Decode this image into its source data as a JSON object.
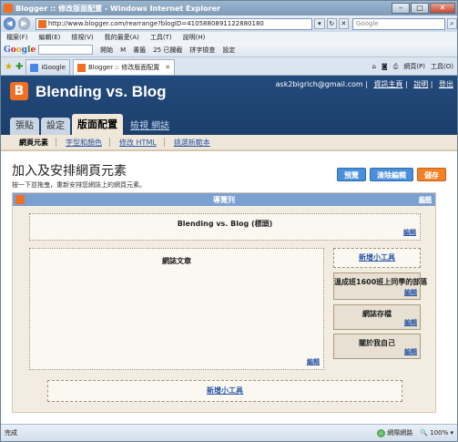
{
  "window": {
    "title": "Blogger :: 修改版面配置 - Windows Internet Explorer",
    "controls": {
      "minimize": "–",
      "maximize": "□",
      "close": "✕"
    }
  },
  "address": {
    "url": "http://www.blogger.com/rearrange?blogID=4105880891122880180",
    "search_placeholder": "Google"
  },
  "menu": [
    "檔案(F)",
    "編輯(E)",
    "檢視(V)",
    "我的最愛(A)",
    "工具(T)",
    "說明(H)"
  ],
  "google_toolbar": {
    "logo": [
      "G",
      "o",
      "o",
      "g",
      "l",
      "e"
    ],
    "items": [
      "開始",
      "M",
      "書籤",
      "25 已攔截",
      "拼字檢查",
      "設定"
    ]
  },
  "tabs": [
    {
      "label": "iGoogle",
      "icon": "igoogle-icon",
      "active": false
    },
    {
      "label": "Blogger :: 修改版面配置",
      "icon": "blogger-icon",
      "active": true
    }
  ],
  "tab_tools": [
    "網頁(P)",
    "工具(O)"
  ],
  "blogger": {
    "blog_name": "Blending vs. Blog",
    "user_email": "ask2bigrich@gmail.com",
    "user_links": [
      "資訊主頁",
      "說明",
      "登出"
    ],
    "main_tabs": [
      {
        "label": "張貼",
        "active": false
      },
      {
        "label": "設定",
        "active": false
      },
      {
        "label": "版面配置",
        "active": true
      },
      {
        "label": "檢視 網誌",
        "active": false,
        "link": true
      }
    ],
    "sub_tabs": [
      {
        "label": "網頁元素",
        "active": true
      },
      {
        "label": "字型和顏色",
        "active": false
      },
      {
        "label": "修改 HTML",
        "active": false
      },
      {
        "label": "挑選新範本",
        "active": false
      }
    ],
    "page_title": "加入及安排網頁元素",
    "page_subtitle": "按一下並拖曳，重新安排您網誌上的網頁元素。",
    "buttons": {
      "preview": "預覽",
      "clear": "清除編輯",
      "save": "儲存"
    },
    "layout": {
      "navbar_label": "導覽列",
      "edit_label": "編輯",
      "header_box": "Blending vs. Blog (標頭)",
      "posts_box": "網誌文章",
      "add_gadget": "新增小工具",
      "sidebar_widgets": [
        "溫成班1600班上同學的部落",
        "網誌存檔",
        "關於我自己"
      ]
    }
  },
  "status": {
    "left": "完成",
    "zone": "網際網路",
    "zoom": "100%"
  }
}
